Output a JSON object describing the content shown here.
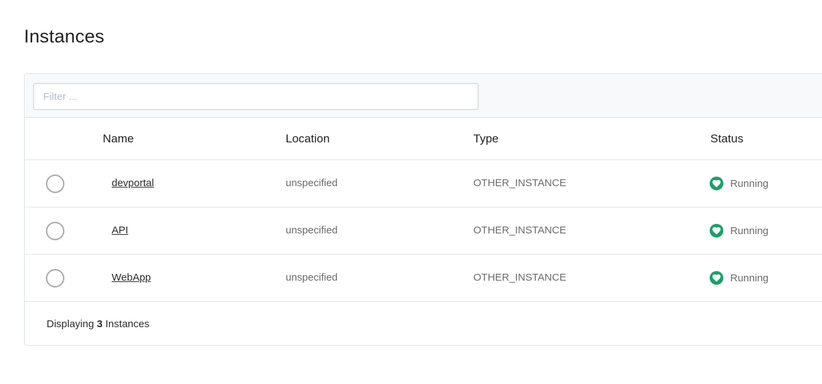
{
  "page": {
    "title": "Instances"
  },
  "filter": {
    "placeholder": "Filter ..."
  },
  "table": {
    "columns": [
      "Name",
      "Location",
      "Type",
      "Status"
    ],
    "rows": [
      {
        "name": "devportal",
        "location": "unspecified",
        "type": "OTHER_INSTANCE",
        "status": "Running",
        "selected": false
      },
      {
        "name": "API",
        "location": "unspecified",
        "type": "OTHER_INSTANCE",
        "status": "Running",
        "selected": false
      },
      {
        "name": "WebApp",
        "location": "unspecified",
        "type": "OTHER_INSTANCE",
        "status": "Running",
        "selected": false
      }
    ]
  },
  "footer": {
    "prefix": "Displaying",
    "count": "3",
    "suffix": "Instances"
  },
  "colors": {
    "status_running": "#1aa16a",
    "border": "#dfe3e8",
    "filter_bar_bg": "#f7f9fb"
  },
  "icons": {
    "status": "heart-icon"
  }
}
